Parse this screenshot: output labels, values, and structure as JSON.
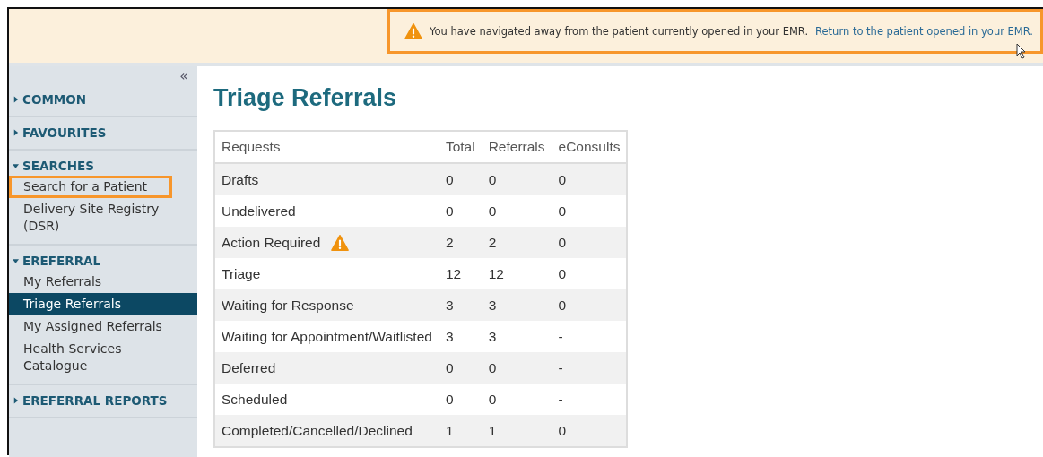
{
  "alert": {
    "message": "You have navigated away from the patient currently opened in your EMR.",
    "link": "Return to the patient opened in your EMR."
  },
  "sidebar": {
    "collapse": "«",
    "sections": [
      {
        "label": "COMMON",
        "expanded": false
      },
      {
        "label": "FAVOURITES",
        "expanded": false
      },
      {
        "label": "SEARCHES",
        "expanded": true,
        "items": [
          {
            "label": "Search for a Patient",
            "selected": false,
            "outlined": true
          },
          {
            "label": "Delivery Site Registry (DSR)",
            "selected": false,
            "outlined": false
          }
        ]
      },
      {
        "label": "EREFERRAL",
        "expanded": true,
        "items": [
          {
            "label": "My Referrals",
            "selected": false,
            "outlined": false
          },
          {
            "label": "Triage Referrals",
            "selected": true,
            "outlined": false
          },
          {
            "label": "My Assigned Referrals",
            "selected": false,
            "outlined": false
          },
          {
            "label": "Health Services Catalogue",
            "selected": false,
            "outlined": false
          }
        ]
      },
      {
        "label": "EREFERRAL REPORTS",
        "expanded": false
      }
    ]
  },
  "page": {
    "title": "Triage Referrals"
  },
  "table": {
    "columns": [
      "Requests",
      "Total",
      "Referrals",
      "eConsults"
    ],
    "rows": [
      {
        "cells": [
          "Drafts",
          "0",
          "0",
          "0"
        ],
        "alert": false
      },
      {
        "cells": [
          "Undelivered",
          "0",
          "0",
          "0"
        ],
        "alert": false
      },
      {
        "cells": [
          "Action Required",
          "2",
          "2",
          "0"
        ],
        "alert": true
      },
      {
        "cells": [
          "Triage",
          "12",
          "12",
          "0"
        ],
        "alert": false
      },
      {
        "cells": [
          "Waiting for Response",
          "3",
          "3",
          "0"
        ],
        "alert": false
      },
      {
        "cells": [
          "Waiting for Appointment/Waitlisted",
          "3",
          "3",
          "-"
        ],
        "alert": false
      },
      {
        "cells": [
          "Deferred",
          "0",
          "0",
          "-"
        ],
        "alert": false
      },
      {
        "cells": [
          "Scheduled",
          "0",
          "0",
          "-"
        ],
        "alert": false
      },
      {
        "cells": [
          "Completed/Cancelled/Declined",
          "1",
          "1",
          "0"
        ],
        "alert": false
      }
    ]
  }
}
